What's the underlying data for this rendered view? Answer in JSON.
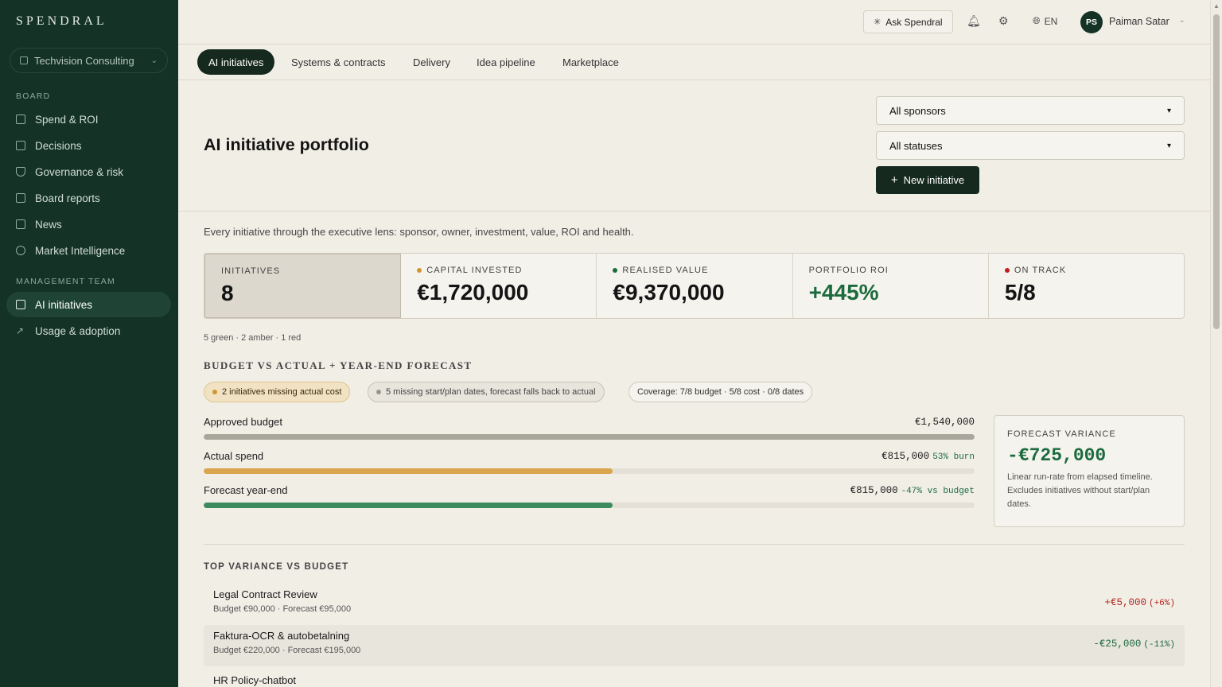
{
  "app": {
    "brand": "SPENDRAL",
    "org_name": "Techvision Consulting"
  },
  "sidebar": {
    "board_heading": "BOARD",
    "board_items": [
      {
        "label": "Spend & ROI",
        "icon": "grid-icon"
      },
      {
        "label": "Decisions",
        "icon": "checkbox-icon"
      },
      {
        "label": "Governance & risk",
        "icon": "shield-icon"
      },
      {
        "label": "Board reports",
        "icon": "report-icon"
      },
      {
        "label": "News",
        "icon": "newspaper-icon"
      },
      {
        "label": "Market Intelligence",
        "icon": "users-icon"
      }
    ],
    "mgmt_heading": "MANAGEMENT TEAM",
    "mgmt_items": [
      {
        "label": "AI initiatives",
        "icon": "layers-icon",
        "active": true
      },
      {
        "label": "Usage & adoption",
        "icon": "trend-icon"
      }
    ]
  },
  "topbar": {
    "ask_label": "Ask Spendral",
    "lang": "EN",
    "user_initials": "PS",
    "user_name": "Paiman Satar"
  },
  "tabs": [
    {
      "label": "AI initiatives",
      "active": true
    },
    {
      "label": "Systems & contracts"
    },
    {
      "label": "Delivery"
    },
    {
      "label": "Idea pipeline"
    },
    {
      "label": "Marketplace"
    }
  ],
  "header": {
    "title": "AI initiative portfolio",
    "sponsor_filter": "All sponsors",
    "status_filter": "All statuses",
    "new_button": "New initiative",
    "subtitle": "Every initiative through the executive lens: sponsor, owner, investment, value, ROI and health."
  },
  "kpis": [
    {
      "label": "INITIATIVES",
      "value": "8",
      "dot": null
    },
    {
      "label": "CAPITAL INVESTED",
      "value": "€1,720,000",
      "dot": "#d1962b"
    },
    {
      "label": "REALISED VALUE",
      "value": "€9,370,000",
      "dot": "#1c6b3f"
    },
    {
      "label": "PORTFOLIO ROI",
      "value": "+445%",
      "dot": null,
      "green": true
    },
    {
      "label": "ON TRACK",
      "value": "5/8",
      "dot": "#c21c1c"
    }
  ],
  "rag_summary": "5 green · 2 amber · 1 red",
  "budget": {
    "heading": "BUDGET VS ACTUAL + YEAR-END FORECAST",
    "chips": [
      "2 initiatives missing actual cost",
      "5 missing start/plan dates, forecast falls back to actual",
      "Coverage: 7/8 budget · 5/8 cost · 0/8 dates"
    ],
    "bars": [
      {
        "label": "Approved budget",
        "value": "€1,540,000",
        "note": "",
        "fraction": 1.0,
        "color": "#a9a69c"
      },
      {
        "label": "Actual spend",
        "value": "€815,000",
        "note": "53% burn",
        "fraction": 0.53,
        "color": "#d9a64e",
        "note_color": "#1c6b3f"
      },
      {
        "label": "Forecast year-end",
        "value": "€815,000",
        "note": "-47% vs budget",
        "fraction": 0.53,
        "color": "#3d8a5e",
        "note_color": "#1c6b3f"
      }
    ],
    "forecast_variance": {
      "label": "FORECAST VARIANCE",
      "value": "-€725,000",
      "note": "Linear run-rate from elapsed timeline. Excludes initiatives without start/plan dates."
    }
  },
  "variance": {
    "heading": "TOP VARIANCE VS BUDGET",
    "rows": [
      {
        "name": "Legal Contract Review",
        "sub": "Budget €90,000 · Forecast €95,000",
        "delta": "+€5,000",
        "pct": "(+6%)",
        "color": "#b3261e"
      },
      {
        "name": "Faktura-OCR & autobetalning",
        "sub": "Budget €220,000 · Forecast €195,000",
        "delta": "-€25,000",
        "pct": "(-11%)",
        "color": "#1c6b3f"
      },
      {
        "name": "HR Policy-chatbot",
        "sub": "",
        "delta": "",
        "pct": "",
        "color": "#1c6b3f"
      }
    ]
  },
  "colors": {
    "sidebar_bg": "#143226",
    "accent_dark": "#16291f",
    "positive": "#1c6b3f",
    "negative": "#b3261e"
  }
}
